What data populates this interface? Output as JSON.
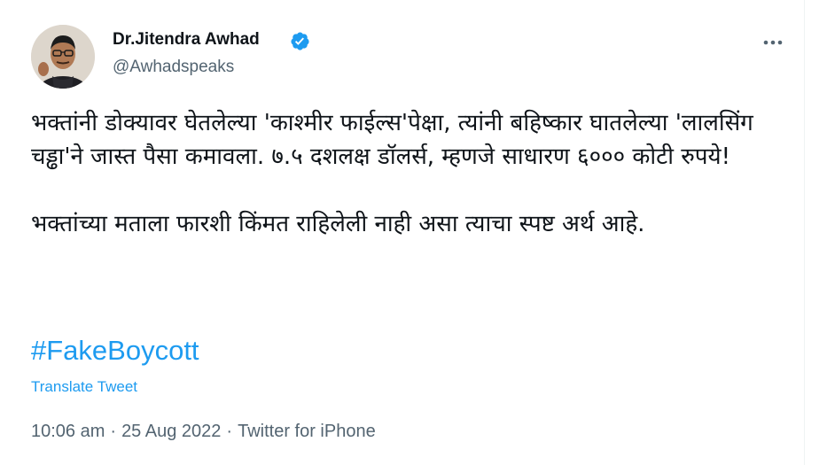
{
  "author": {
    "display_name": "Dr.Jitendra Awhad",
    "handle": "@Awhadspeaks",
    "verified": true,
    "avatar_icon": "profile-photo"
  },
  "tweet": {
    "paragraph_1": "भक्तांनी डोक्यावर घेतलेल्या 'काश्मीर फाईल्स'पेक्षा, त्यांनी बहिष्कार घातलेल्या 'लालसिंग चड्ढा'ने जास्त पैसा कमावला. ७.५ दशलक्ष डॉलर्स, म्हणजे साधारण ६००० कोटी रुपये!",
    "paragraph_2": "भक्तांच्या मताला फारशी किंमत राहिलेली नाही असा त्याचा स्पष्ट अर्थ आहे.",
    "hashtag": "#FakeBoycott",
    "translate_label": "Translate Tweet"
  },
  "meta": {
    "time": "10:06 am",
    "separator": "·",
    "date": "25 Aug 2022",
    "source": "Twitter for iPhone"
  },
  "colors": {
    "accent": "#1d9bf0",
    "text": "#0f1419",
    "secondary": "#536471"
  },
  "icons": {
    "verified": "verified-badge-icon",
    "more": "more-horizontal-icon"
  }
}
